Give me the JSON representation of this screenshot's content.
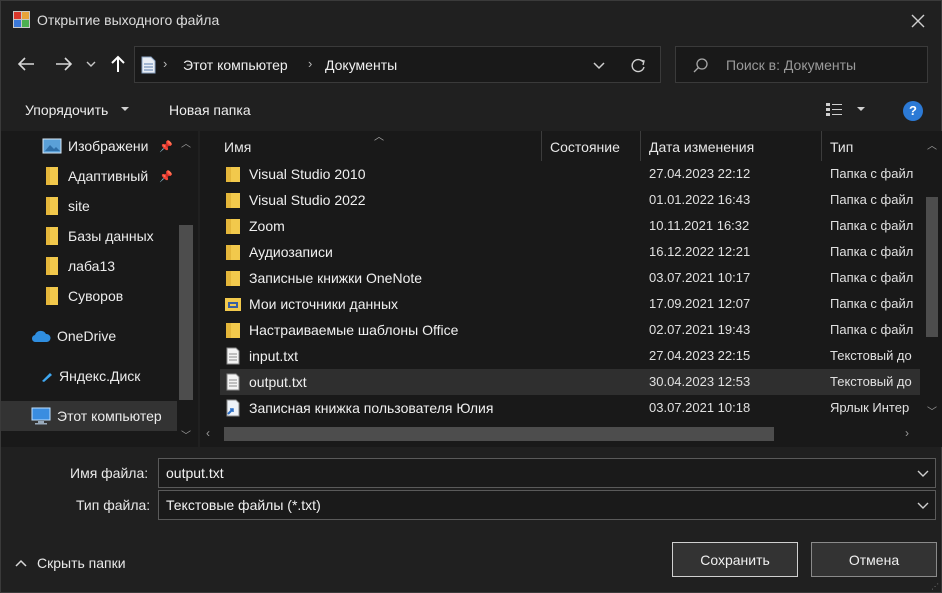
{
  "window": {
    "title": "Открытие выходного файла"
  },
  "address": {
    "crumbs": [
      "Этот компьютер",
      "Документы"
    ],
    "search_placeholder": "Поиск в: Документы"
  },
  "toolbar": {
    "organize_label": "Упорядочить",
    "new_folder_label": "Новая папка",
    "help_label": "?"
  },
  "nav": {
    "items": [
      {
        "label": "Изображени",
        "icon": "pictures-icon",
        "pinned": true
      },
      {
        "label": "Адаптивный",
        "icon": "folder-icon",
        "pinned": true
      },
      {
        "label": "site",
        "icon": "folder-icon"
      },
      {
        "label": "Базы данных",
        "icon": "folder-icon"
      },
      {
        "label": "лаба13",
        "icon": "folder-icon"
      },
      {
        "label": "Суворов",
        "icon": "folder-icon"
      },
      {
        "label": "OneDrive",
        "icon": "cloud-icon"
      },
      {
        "label": "Яндекс.Диск",
        "icon": "yandex-disk-icon"
      },
      {
        "label": "Этот компьютер",
        "icon": "computer-icon",
        "selected": true
      }
    ]
  },
  "columns": {
    "name": "Имя",
    "status": "Состояние",
    "date": "Дата изменения",
    "type": "Тип"
  },
  "files": [
    {
      "name": "Visual Studio 2010",
      "date": "27.04.2023 22:12",
      "type": "Папка с файл",
      "icon": "folder-icon"
    },
    {
      "name": "Visual Studio 2022",
      "date": "01.01.2022 16:43",
      "type": "Папка с файл",
      "icon": "folder-icon"
    },
    {
      "name": "Zoom",
      "date": "10.11.2021 16:32",
      "type": "Папка с файл",
      "icon": "folder-icon"
    },
    {
      "name": "Аудиозаписи",
      "date": "16.12.2022 12:21",
      "type": "Папка с файл",
      "icon": "folder-icon"
    },
    {
      "name": "Записные книжки OneNote",
      "date": "03.07.2021 10:17",
      "type": "Папка с файл",
      "icon": "folder-icon"
    },
    {
      "name": "Мои источники данных",
      "date": "17.09.2021 12:07",
      "type": "Папка с файл",
      "icon": "data-sources-folder-icon"
    },
    {
      "name": "Настраиваемые шаблоны Office",
      "date": "02.07.2021 19:43",
      "type": "Папка с файл",
      "icon": "folder-icon"
    },
    {
      "name": "input.txt",
      "date": "27.04.2023 22:15",
      "type": "Текстовый до",
      "icon": "text-file-icon"
    },
    {
      "name": "output.txt",
      "date": "30.04.2023 12:53",
      "type": "Текстовый до",
      "icon": "text-file-icon",
      "selected": true
    },
    {
      "name": "Записная книжка пользователя Юлия",
      "date": "03.07.2021 10:18",
      "type": "Ярлык Интер",
      "icon": "shortcut-icon"
    }
  ],
  "filename": {
    "label": "Имя файла:",
    "value": "output.txt"
  },
  "filetype": {
    "label": "Тип файла:",
    "value": "Текстовые файлы (*.txt)"
  },
  "footer": {
    "hide_folders_label": "Скрыть папки",
    "save_label": "Сохранить",
    "cancel_label": "Отмена"
  },
  "colors": {
    "folder": "#f2c94c",
    "accent": "#2c7ad6",
    "background": "#202020",
    "pane": "#191919"
  }
}
